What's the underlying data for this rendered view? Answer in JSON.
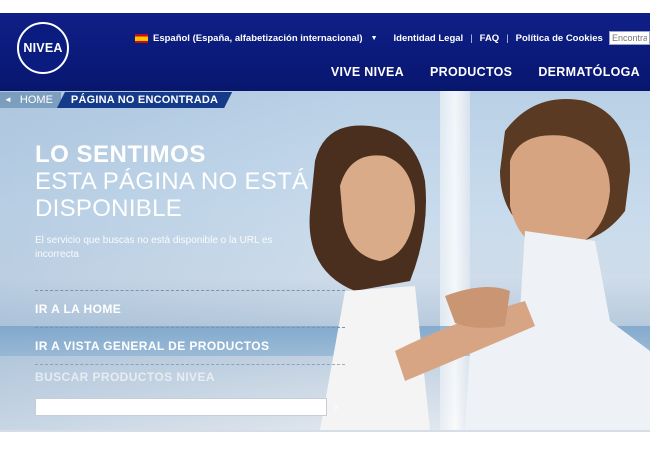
{
  "header": {
    "logo_text": "NIVEA",
    "language": "Español (España, alfabetización internacional)",
    "top_links": [
      "Identidad Legal",
      "FAQ",
      "Política de Cookies"
    ],
    "search_placeholder": "Encontrar",
    "main_nav": [
      "VIVE NIVEA",
      "PRODUCTOS",
      "DERMATÓLOGA"
    ],
    "brand_color": "#0f1f86"
  },
  "breadcrumb": {
    "home": "HOME",
    "current": "PÁGINA NO ENCONTRADA"
  },
  "hero": {
    "headline_bold": "LO SENTIMOS",
    "headline_line2": "ESTA PÁGINA NO ESTÁ",
    "headline_line3": "DISPONIBLE",
    "description": "El servicio que buscas no está disponible o la URL es incorrecta",
    "links": [
      "IR A LA HOME",
      "IR A VISTA GENERAL DE PRODUCTOS"
    ],
    "search_label": "BUSCAR PRODUCTOS NIVEA",
    "search_value": ""
  }
}
